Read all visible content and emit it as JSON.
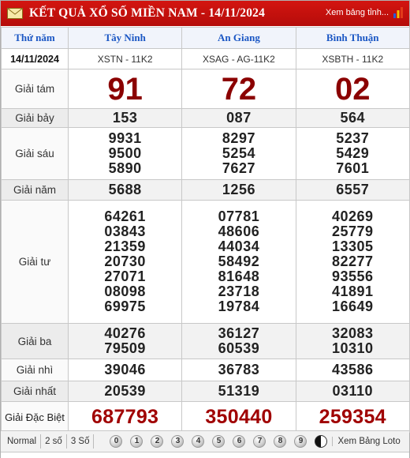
{
  "header": {
    "title": "KẾT QUẢ XỔ SỐ MIỀN NAM - 14/11/2024",
    "view_link": "Xem bảng tỉnh...",
    "bg_color": "#d31510"
  },
  "table": {
    "corner_label": "Thứ năm",
    "date": "14/11/2024",
    "provinces": [
      "Tây Ninh",
      "An Giang",
      "Bình Thuận"
    ],
    "codes": [
      "XSTN - 11K2",
      "XSAG - AG-11K2",
      "XSBTH - 11K2"
    ],
    "prizes": {
      "tam": {
        "label": "Giải tám",
        "values": [
          "91",
          "72",
          "02"
        ]
      },
      "bay": {
        "label": "Giải bảy",
        "values": [
          "153",
          "087",
          "564"
        ]
      },
      "sau": {
        "label": "Giải sáu",
        "values": [
          [
            "9931",
            "9500",
            "5890"
          ],
          [
            "8297",
            "5254",
            "7627"
          ],
          [
            "5237",
            "5429",
            "7601"
          ]
        ]
      },
      "nam": {
        "label": "Giải năm",
        "values": [
          "5688",
          "1256",
          "6557"
        ]
      },
      "tu": {
        "label": "Giải tư",
        "values": [
          [
            "64261",
            "03843",
            "21359",
            "20730",
            "27071",
            "08098",
            "69975"
          ],
          [
            "07781",
            "48606",
            "44034",
            "58492",
            "81648",
            "23718",
            "19784"
          ],
          [
            "40269",
            "25779",
            "13305",
            "82277",
            "93556",
            "41891",
            "16649"
          ]
        ]
      },
      "ba": {
        "label": "Giải ba",
        "values": [
          [
            "40276",
            "79509"
          ],
          [
            "36127",
            "60539"
          ],
          [
            "32083",
            "10310"
          ]
        ]
      },
      "nhi": {
        "label": "Giải nhì",
        "values": [
          "39046",
          "36783",
          "43586"
        ]
      },
      "nhat": {
        "label": "Giải nhất",
        "values": [
          "20539",
          "51319",
          "03110"
        ]
      },
      "db": {
        "label": "Giải Đặc Biệt",
        "values": [
          "687793",
          "350440",
          "259354"
        ]
      }
    }
  },
  "toolbar": {
    "buttons": [
      "Normal",
      "2 số",
      "3 Số"
    ],
    "digits": [
      "0",
      "1",
      "2",
      "3",
      "4",
      "5",
      "6",
      "7",
      "8",
      "9"
    ],
    "view_loto": "Xem Bảng Loto"
  }
}
